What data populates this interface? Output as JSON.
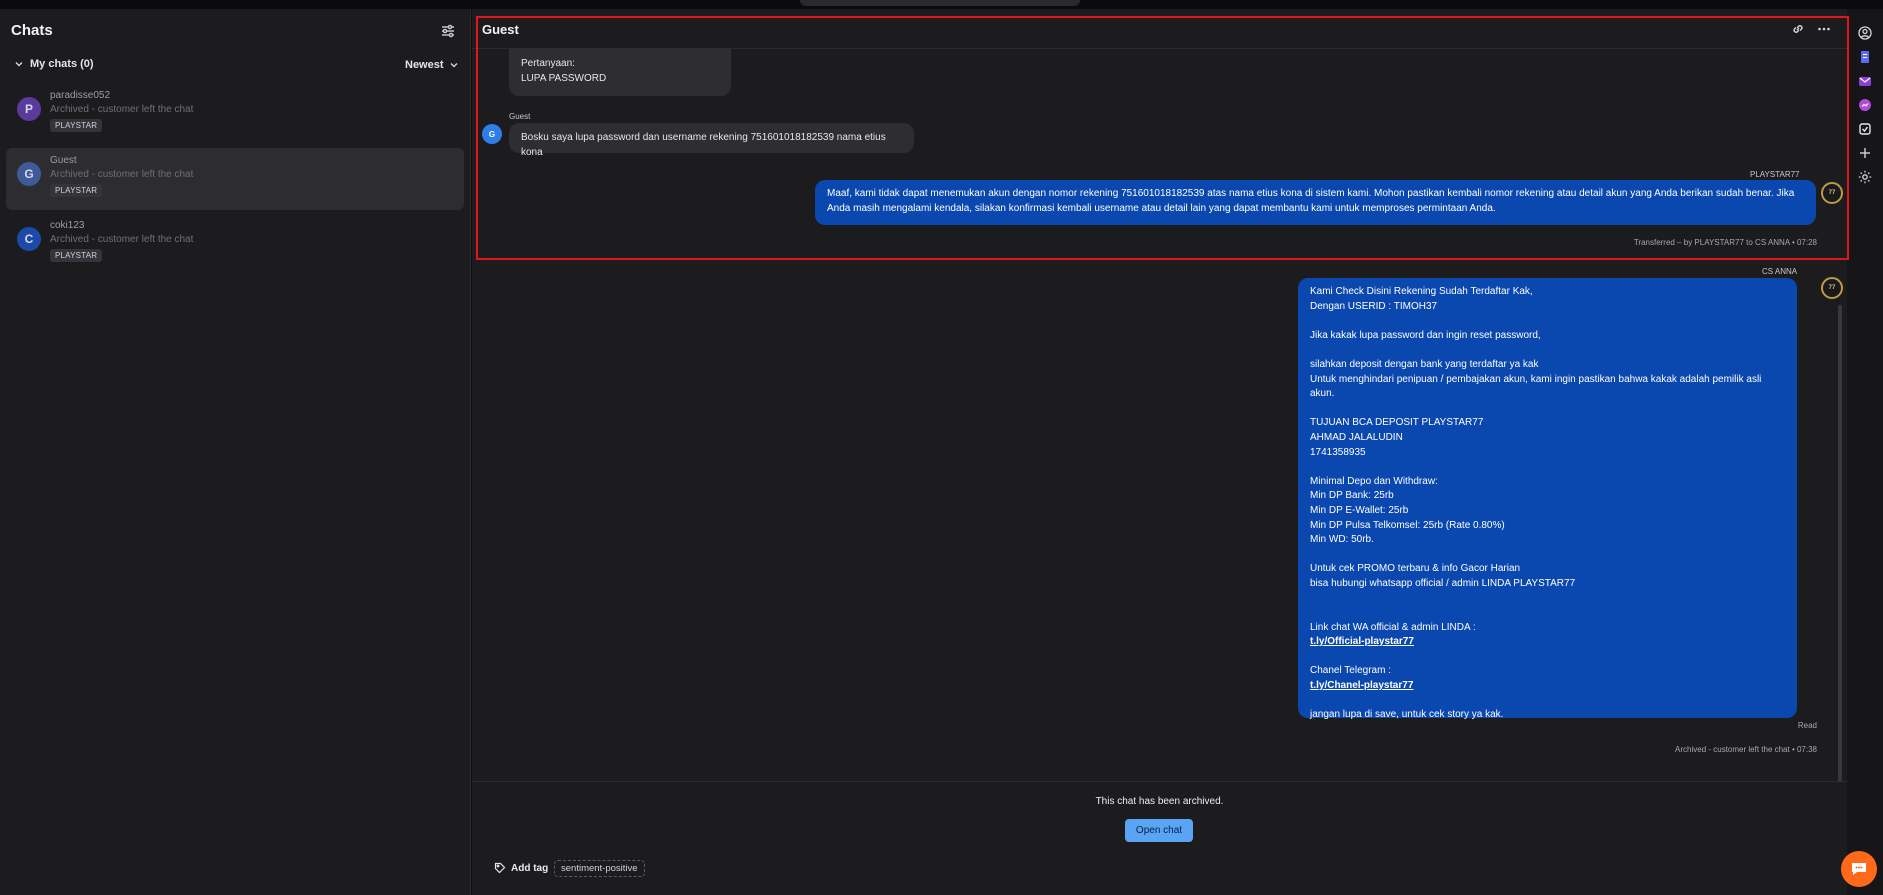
{
  "sidebar": {
    "title": "Chats",
    "my_chats_label": "My chats (0)",
    "sort_label": "Newest",
    "chats": [
      {
        "initial": "P",
        "name": "paradisse052",
        "preview": "Archived - customer left the chat",
        "tag": "PLAYSTAR",
        "color": "#5b3a9e"
      },
      {
        "initial": "G",
        "name": "Guest",
        "preview": "Archived - customer left the chat",
        "tag": "PLAYSTAR",
        "color": "#3e5a98"
      },
      {
        "initial": "C",
        "name": "coki123",
        "preview": "Archived - customer left the chat",
        "tag": "PLAYSTAR",
        "color": "#1d4aa8"
      }
    ]
  },
  "header": {
    "title": "Guest"
  },
  "messages": {
    "first_bubble_line1": "Pertanyaan:",
    "first_bubble_line2": "LUPA PASSWORD",
    "guest_sender": "Guest",
    "guest_initial": "G",
    "guest_text": "Bosku saya lupa password dan username rekening 751601018182539 nama etius kona",
    "agent1_sender": "PLAYSTAR77",
    "agent1_text": "Maaf, kami tidak dapat menemukan akun dengan nomor rekening 751601018182539 atas nama etius kona di sistem kami. Mohon pastikan kembali nomor rekening atau detail akun yang Anda berikan sudah benar. Jika Anda masih mengalami kendala, silakan konfirmasi kembali username atau detail lain yang dapat membantu kami untuk memproses permintaan Anda.",
    "transfer_note": "Transferred – by PLAYSTAR77 to CS ANNA • 07:28",
    "agent2_sender": "CS ANNA",
    "agent2_lines": [
      "Kami Check Disini Rekening Sudah Terdaftar Kak,",
      "Dengan USERID : TIMOH37",
      "",
      "Jika kakak lupa password dan ingin reset password,",
      "",
      "silahkan deposit dengan bank yang terdaftar ya kak",
      "Untuk menghindari penipuan / pembajakan akun, kami ingin pastikan bahwa kakak adalah pemilik asli akun.",
      "",
      "TUJUAN BCA DEPOSIT PLAYSTAR77",
      "AHMAD JALALUDIN",
      "1741358935",
      "",
      "Minimal Depo dan Withdraw:",
      "Min DP Bank: 25rb",
      "Min DP E-Wallet: 25rb",
      "Min DP Pulsa Telkomsel: 25rb (Rate 0.80%)",
      "Min WD: 50rb.",
      "",
      "Untuk cek PROMO terbaru & info Gacor Harian",
      "bisa hubungi whatsapp official / admin LINDA PLAYSTAR77",
      "",
      "",
      "Link chat WA official & admin LINDA :"
    ],
    "agent2_link1": "t.ly/Official-playstar77",
    "agent2_telegram_label": "Chanel Telegram :",
    "agent2_link2": "t.ly/Chanel-playstar77",
    "agent2_closing": "jangan lupa di save, untuk cek story ya kak.",
    "read_status": "Read",
    "archived_note": "Archived - customer left the chat • 07:38",
    "agent_avatar_text": "77"
  },
  "footer": {
    "archived_text": "This chat has been archived.",
    "open_chat_label": "Open chat",
    "add_tag_label": "Add tag",
    "tag": "sentiment-positive"
  },
  "colors": {
    "accent_button": "#5aa4f6",
    "agent_bubble": "#0a48b0",
    "highlight": "#e0161b",
    "fab": "#ff6a1a"
  }
}
